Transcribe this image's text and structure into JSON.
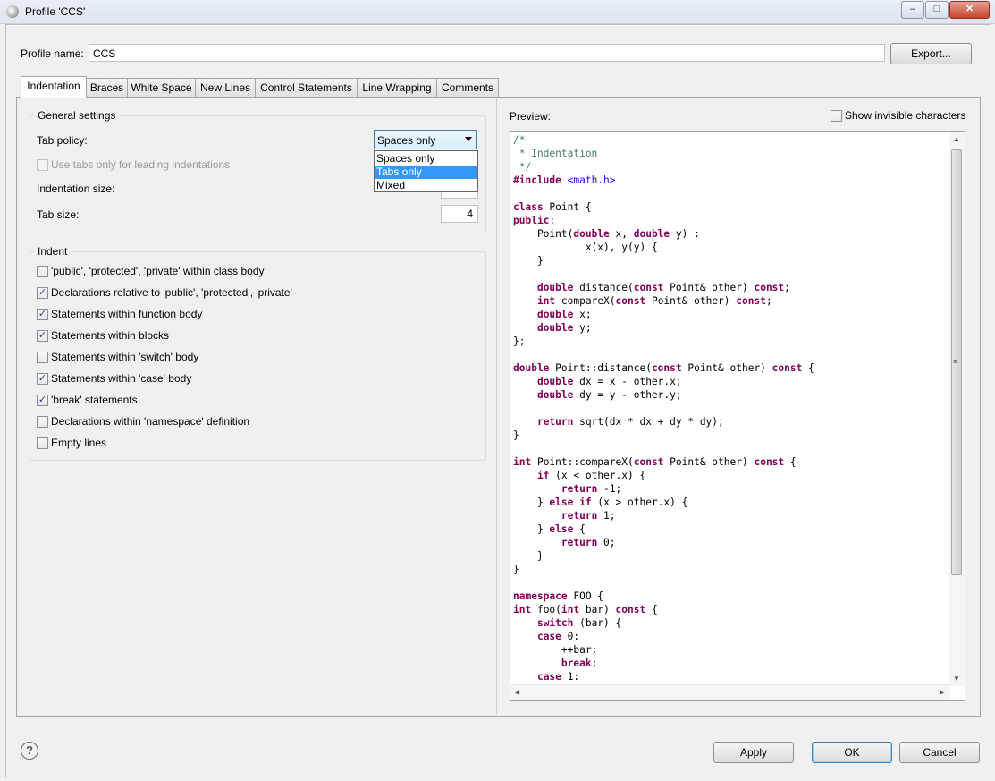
{
  "window": {
    "title": "Profile 'CCS'",
    "controls": {
      "minimize": "–",
      "maximize": "□",
      "close": "✕"
    }
  },
  "profile": {
    "label": "Profile name:",
    "value": "CCS",
    "export_label": "Export..."
  },
  "tabs": [
    "Indentation",
    "Braces",
    "White Space",
    "New Lines",
    "Control Statements",
    "Line Wrapping",
    "Comments"
  ],
  "general": {
    "title": "General settings",
    "tab_policy_label": "Tab policy:",
    "tab_policy_value": "Spaces only",
    "tab_policy_options": [
      "Spaces only",
      "Tabs only",
      "Mixed"
    ],
    "use_tabs_label": "Use tabs only for leading indentations",
    "indent_size_label": "Indentation size:",
    "tab_size_label": "Tab size:",
    "tab_size_value": "4"
  },
  "indent": {
    "title": "Indent",
    "items": [
      {
        "label": "'public', 'protected', 'private' within class body",
        "checked": false
      },
      {
        "label": "Declarations relative to 'public', 'protected', 'private'",
        "checked": true
      },
      {
        "label": "Statements within function body",
        "checked": true
      },
      {
        "label": "Statements within blocks",
        "checked": true
      },
      {
        "label": "Statements within 'switch' body",
        "checked": false
      },
      {
        "label": "Statements within 'case' body",
        "checked": true
      },
      {
        "label": "'break' statements",
        "checked": true
      },
      {
        "label": "Declarations within 'namespace' definition",
        "checked": false
      },
      {
        "label": "Empty lines",
        "checked": false
      }
    ]
  },
  "preview": {
    "label": "Preview:",
    "show_invisible_label": "Show invisible characters",
    "code_lines": [
      "/*",
      " * Indentation",
      " */",
      "#include <math.h>",
      "",
      "class Point {",
      "public:",
      "    Point(double x, double y) :",
      "            x(x), y(y) {",
      "    }",
      "",
      "    double distance(const Point& other) const;",
      "    int compareX(const Point& other) const;",
      "    double x;",
      "    double y;",
      "};",
      "",
      "double Point::distance(const Point& other) const {",
      "    double dx = x - other.x;",
      "    double dy = y - other.y;",
      "",
      "    return sqrt(dx * dx + dy * dy);",
      "}",
      "",
      "int Point::compareX(const Point& other) const {",
      "    if (x < other.x) {",
      "        return -1;",
      "    } else if (x > other.x) {",
      "        return 1;",
      "    } else {",
      "        return 0;",
      "    }",
      "}",
      "",
      "namespace FOO {",
      "int foo(int bar) const {",
      "    switch (bar) {",
      "    case 0:",
      "        ++bar;",
      "        break;",
      "    case 1:"
    ]
  },
  "footer": {
    "help": "?",
    "apply": "Apply",
    "ok": "OK",
    "cancel": "Cancel"
  }
}
